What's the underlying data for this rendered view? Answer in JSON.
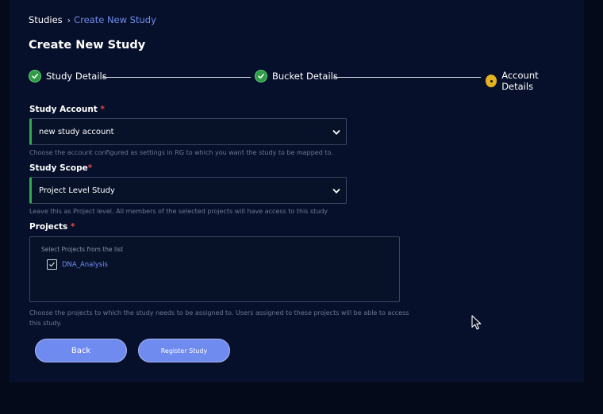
{
  "breadcrumb": {
    "root": "Studies",
    "separator": "›",
    "current": "Create New Study"
  },
  "page": {
    "title": "Create New Study"
  },
  "steps": [
    {
      "label": "Study Details",
      "status": "completed"
    },
    {
      "label": "Bucket Details",
      "status": "completed"
    },
    {
      "label": "Account Details",
      "status": "current"
    }
  ],
  "form": {
    "study_account": {
      "label": "Study Account",
      "required_mark": "*",
      "value": "new study account",
      "helper": "Choose the account configured as settings in RG to which you want the study to be mapped to."
    },
    "study_scope": {
      "label": "Study Scope",
      "required_mark": "*",
      "value": "Project Level Study",
      "helper": "Leave this as Project level. All members of the selected projects will have access to this study"
    },
    "projects": {
      "label": "Projects",
      "required_mark": "*",
      "hint": "Select Projects from the list",
      "items": [
        {
          "label": "DNA_Analysis",
          "checked": true
        }
      ],
      "helper_line1": "Choose the projects to which the study needs to be assigned to. Users assigned to these projects will be able to access",
      "helper_line2": "this study."
    }
  },
  "buttons": {
    "back": "Back",
    "register": "Register Study"
  },
  "colors": {
    "background": "#050a1a",
    "panel": "#07102a",
    "accent": "#6f8bef",
    "success": "#2e9b45",
    "current_step": "#e3b321",
    "required": "#e14b4b"
  }
}
